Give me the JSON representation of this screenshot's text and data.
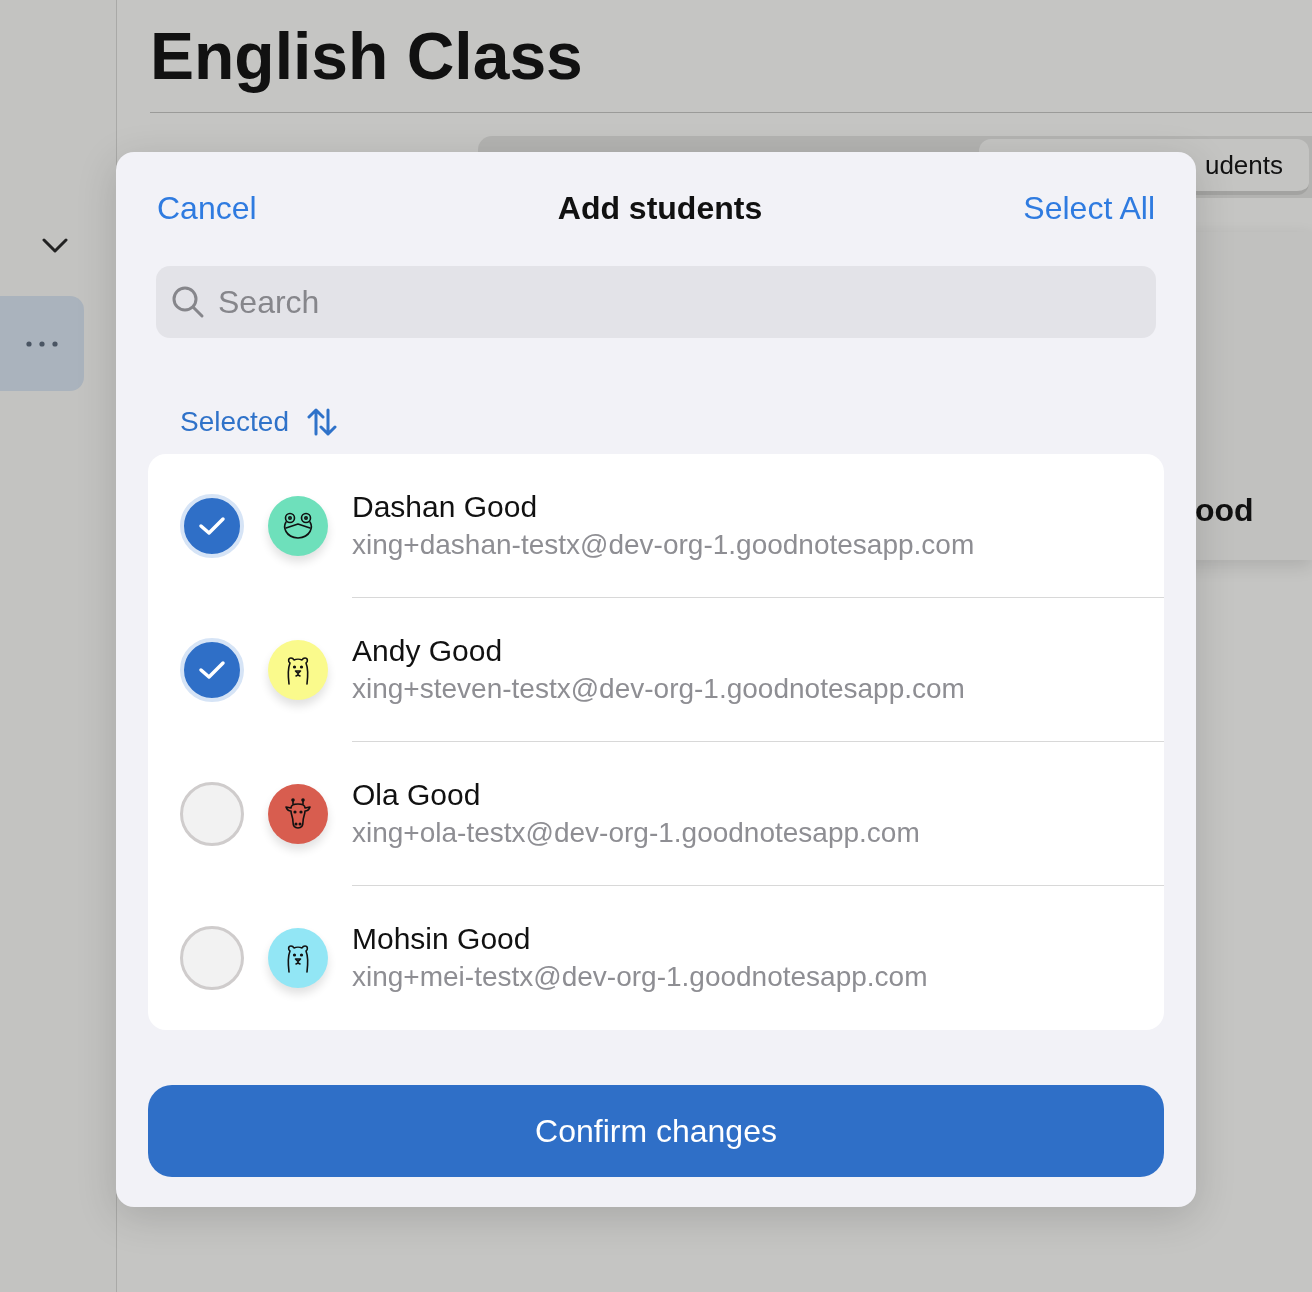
{
  "page": {
    "title": "English Class",
    "segment_label": "udents",
    "card_text": "ood"
  },
  "dialog": {
    "cancel": "Cancel",
    "title": "Add students",
    "select_all": "Select All",
    "search": {
      "placeholder": "Search"
    },
    "sort_label": "Selected",
    "students": [
      {
        "name": "Dashan Good",
        "email": "xing+dashan-testx@dev-org-1.goodnotesapp.com",
        "checked": true,
        "kind": "frog",
        "color": "#6ee0bb"
      },
      {
        "name": "Andy Good",
        "email": "xing+steven-testx@dev-org-1.goodnotesapp.com",
        "checked": true,
        "kind": "bear",
        "color": "#fafa8c"
      },
      {
        "name": "Ola Good",
        "email": "xing+ola-testx@dev-org-1.goodnotesapp.com",
        "checked": false,
        "kind": "giraffe",
        "color": "#d85d4f"
      },
      {
        "name": "Mohsin Good",
        "email": "xing+mei-testx@dev-org-1.goodnotesapp.com",
        "checked": false,
        "kind": "bear",
        "color": "#92e6f5"
      }
    ],
    "confirm": "Confirm changes"
  }
}
